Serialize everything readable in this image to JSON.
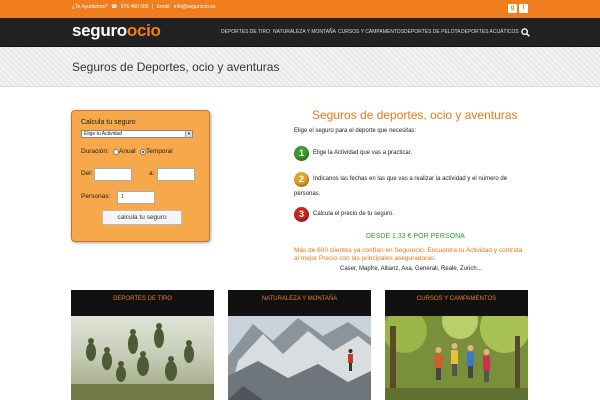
{
  "topbar": {
    "contact_prefix": "¿Te Ayudamos?",
    "phone": "976 460 500",
    "separator": "|",
    "email_label": "Email:",
    "email": "info@segurocio.es",
    "social": [
      {
        "icon": "google-plus-icon",
        "glyph": "g"
      },
      {
        "icon": "facebook-icon",
        "glyph": "f"
      }
    ]
  },
  "header": {
    "logo_part1": "seguro",
    "logo_part2": "ocio",
    "nav": [
      {
        "label": "DEPORTES DE TIRO"
      },
      {
        "label": "NATURALEZA Y MONTAÑA"
      },
      {
        "label": "CURSOS Y CAMPAMENTOS"
      },
      {
        "label": "DEPORTES DE PELOTA"
      },
      {
        "label": "DEPORTES ACUÁTICOS"
      }
    ]
  },
  "page_title": "Seguros de Deportes, ocio y aventuras",
  "form": {
    "title": "Calcula tu seguro",
    "activity_select": "Elige tu Actividad",
    "duration_label": "Duración:",
    "option_annual": "Anual",
    "option_temporal": "Temporal",
    "selected_option": "Temporal",
    "from_label": "Del:",
    "to_label": "a:",
    "from_value": "",
    "to_value": "",
    "persons_label": "Personas:",
    "persons_value": "1",
    "submit_label": "calcula tu seguro"
  },
  "info": {
    "title": "Seguros de deportes, ocio y aventuras",
    "intro": "Elige el seguro para el deporte que necesitas:",
    "steps": [
      {
        "number": "1",
        "text": "Elige la Actividad que vas a practicar."
      },
      {
        "number": "2",
        "text_line1": "Indicanos las fechas en las que vas a realizar la actividad y el número de",
        "text_line2": "personas."
      },
      {
        "number": "3",
        "text": "Calcula el precio de tu seguro."
      }
    ],
    "price": "DESDE 1,33 € POR PERSONA",
    "promo": "Más de 600 clientes ya confían en Segurocio. Encuentra tu Actividad y contrata al mejor Precio con las principales aseguradoras.",
    "insurers": "Caser, Mapfre, Allianz, Axa, Generali, Reale, Zurich..."
  },
  "cards": [
    {
      "title": "DEPORTES DE TIRO"
    },
    {
      "title": "NATURALEZA Y MONTAÑA"
    },
    {
      "title": "CURSOS Y CAMPAMENTOS"
    }
  ],
  "colors": {
    "accent": "#f07e1f",
    "header_bg": "#222222",
    "form_bg": "#f7a84a",
    "price_green": "#2f9a2f"
  }
}
